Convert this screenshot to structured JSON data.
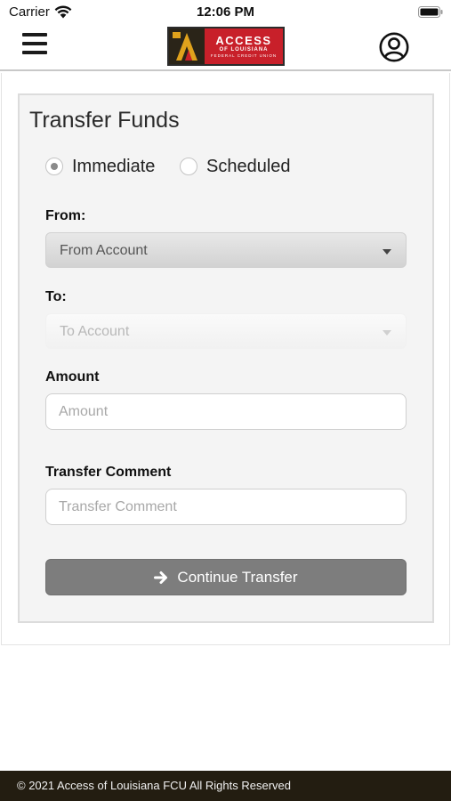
{
  "status_bar": {
    "carrier": "Carrier",
    "time": "12:06 PM"
  },
  "header": {
    "menu_icon": "hamburger-menu-icon",
    "logo": {
      "line1": "ACCESS",
      "line2": "OF LOUISIANA",
      "line3": "FEDERAL CREDIT UNION"
    },
    "profile_icon": "user-circle-icon"
  },
  "form": {
    "title": "Transfer Funds",
    "transfer_type": {
      "options": [
        "Immediate",
        "Scheduled"
      ],
      "selected": "Immediate"
    },
    "from": {
      "label": "From:",
      "value": "From Account"
    },
    "to": {
      "label": "To:",
      "value": "To Account"
    },
    "amount": {
      "label": "Amount",
      "placeholder": "Amount",
      "value": ""
    },
    "comment": {
      "label": "Transfer Comment",
      "placeholder": "Transfer Comment",
      "value": ""
    },
    "continue_button": {
      "label": "Continue Transfer",
      "icon": "arrow-right-icon"
    }
  },
  "footer": {
    "text": "© 2021 Access of Louisiana FCU All Rights Reserved"
  },
  "colors": {
    "brand_red": "#c8202a",
    "brand_dark": "#231d11",
    "button_gray": "#7d7d7d"
  }
}
